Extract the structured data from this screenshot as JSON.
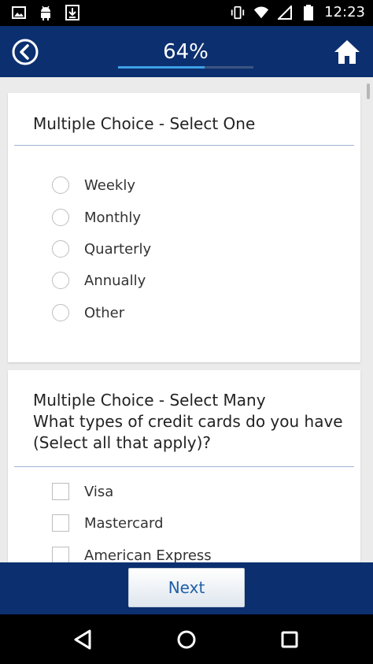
{
  "status_bar": {
    "time": "12:23",
    "left_icons": [
      "image-icon",
      "android-icon",
      "download-icon"
    ],
    "right_icons": [
      "vibrate-icon",
      "wifi-icon",
      "signal-icon",
      "battery-icon"
    ]
  },
  "header": {
    "progress_label": "64%",
    "progress_value": 64,
    "back_icon": "back-circle-icon",
    "home_icon": "home-icon"
  },
  "questions": [
    {
      "title": "Multiple Choice - Select One",
      "options": [
        "Weekly",
        "Monthly",
        "Quarterly",
        "Annually",
        "Other"
      ]
    },
    {
      "title": "Multiple Choice - Select Many\nWhat types of credit cards do you have\n(Select all that apply)?",
      "options": [
        "Visa",
        "Mastercard",
        "American Express"
      ]
    }
  ],
  "footer": {
    "next_label": "Next"
  },
  "colors": {
    "header_bg": "#0c2f6f",
    "accent": "#3ea0e6",
    "next_text": "#1f5fa8"
  }
}
